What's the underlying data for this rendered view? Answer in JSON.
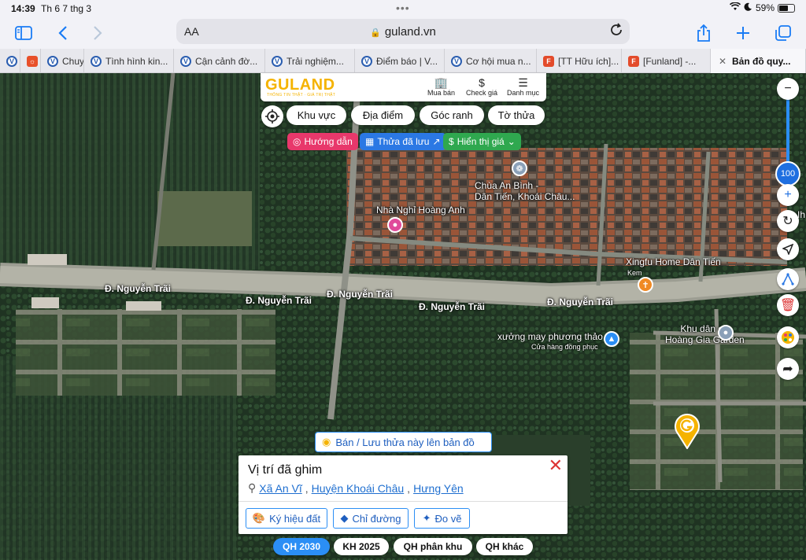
{
  "status": {
    "time": "14:39",
    "date": "Th 6 7 thg 3",
    "battery": "59%",
    "battery_level": 0.59
  },
  "browser": {
    "text_size_label": "AA",
    "url": "guland.vn"
  },
  "tabs": [
    {
      "title": "",
      "favicon": "v"
    },
    {
      "title": "",
      "favicon": "s"
    },
    {
      "title": "Chuy",
      "favicon": "v"
    },
    {
      "title": "Tình hình kin...",
      "favicon": "v"
    },
    {
      "title": "Cận cảnh đờ...",
      "favicon": "v"
    },
    {
      "title": "Trải nghiệm...",
      "favicon": "v"
    },
    {
      "title": "Điểm báo | V...",
      "favicon": "v"
    },
    {
      "title": "Cơ hội mua n...",
      "favicon": "v"
    },
    {
      "title": "[TT Hữu ích]...",
      "favicon": "r"
    },
    {
      "title": "[Funland] -...",
      "favicon": "r"
    },
    {
      "title": "Bản đồ quy...",
      "favicon": "x",
      "active": true
    }
  ],
  "app": {
    "logo": "GULAND",
    "logo_tagline": "THÔNG TIN THẬT · GIÁ TRỊ THẬT",
    "nav": {
      "buy": "Mua bán",
      "check_price": "Check giá",
      "menu": "Danh mục"
    },
    "filter_chips": [
      "Khu vực",
      "Địa điểm",
      "Góc ranh",
      "Tờ thửa"
    ],
    "actions": {
      "directions": "Hướng dẫn",
      "saved": "Thửa đã lưu",
      "show_price": "Hiển thị giá"
    },
    "zoom_level": "100"
  },
  "map": {
    "roads": [
      "Đ. Nguyễn Trãi",
      "Đ. Nguyễn Trãi",
      "Đ. Nguyễn Trãi",
      "Đ. Nguyễn Trãi",
      "Đ. Nguyễn Trãi"
    ],
    "pois": {
      "pagoda_line1": "Chùa An Bình -",
      "pagoda_line2": "Dân Tiến, Khoái Châu...",
      "guesthouse": "Nhà Nghỉ Hoàng Anh",
      "xingfu": "Xingfu Home Dân Tiến",
      "xingfu_sub": "Kem",
      "factory": "xưởng may phương thảo",
      "factory_sub": "Cửa hàng đồng phục",
      "residential_line1": "Khu dân cư",
      "residential_line2": "Hoàng Gia Garden"
    },
    "edge_label": "Ih"
  },
  "pin_panel": {
    "save_banner": "Bán / Lưu thửa này lên bản đồ",
    "title": "Vị trí đã ghim",
    "commune": "Xã An Vĩ",
    "district": "Huyện Khoái Châu",
    "province": "Hưng Yên",
    "buttons": {
      "symbol": "Ký hiệu đất",
      "directions": "Chỉ đường",
      "measure": "Đo vẽ"
    }
  },
  "layer_tabs": [
    "QH 2030",
    "KH 2025",
    "QH phân khu",
    "QH khác"
  ],
  "colors": {
    "accent": "#2b8ef5",
    "brand": "#f5b300",
    "directions_pill": "#e8386b",
    "saved_pill": "#2b78e4",
    "price_pill": "#2fa84f",
    "close": "#d33333"
  }
}
